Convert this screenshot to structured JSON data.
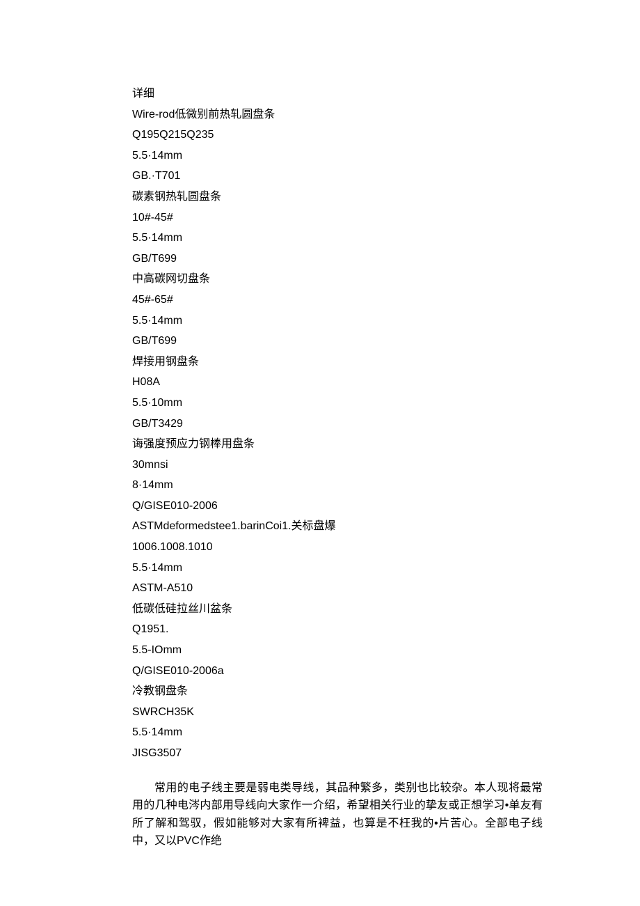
{
  "heading": "详细",
  "groups": [
    {
      "title": "Wire-rod低微别前热轧圆盘条",
      "lines": [
        "Q195Q215Q235",
        "5.5·14mm",
        "GB.·T701"
      ]
    },
    {
      "title": "碳素钢热轧圆盘条",
      "lines": [
        "10#-45#",
        "5.5·14mm",
        "GB/T699"
      ]
    },
    {
      "title": "中高碳网切盘条",
      "lines": [
        "45#-65#",
        "5.5·14mm",
        "GB/T699"
      ]
    },
    {
      "title": "焊接用钢盘条",
      "lines": [
        "H08A",
        "5.5·10mm",
        "GB/T3429"
      ]
    },
    {
      "title": "诲强度预应力钢棒用盘条",
      "lines": [
        "30mnsi",
        "8·14mm",
        "Q/GISE010-2006"
      ]
    },
    {
      "title": "ASTMdeformedstee1.barinCoi1.关标盘爆",
      "lines": [
        "1006.1008.1010",
        "5.5·14mm",
        "ASTM-A510"
      ]
    },
    {
      "title": "低碳低硅拉丝川盆条",
      "lines": [
        "Q1951.",
        "5.5-IOmm",
        "Q/GISE010-2006a"
      ]
    },
    {
      "title": "冷教钢盘条",
      "lines": [
        "SWRCH35K",
        "5.5·14mm",
        "JISG3507"
      ]
    }
  ],
  "paragraph": "常用的电子线主要是弱电类导线，其品种繁多，类别也比较杂。本人现将最常用的几种电涔内部用导线向大家作一介绍，希望相关行业的挚友或正想学习•单友有所了解和驾驭，假如能够对大家有所裨益，也算是不枉我的•片苦心。全部电子线中，又以PVC作绝"
}
